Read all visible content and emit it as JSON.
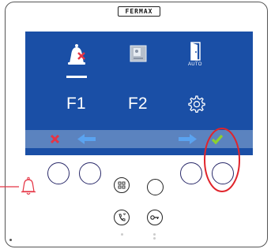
{
  "device": {
    "brand_label": "FERMAX"
  },
  "screen": {
    "icons": [
      "do-not-disturb-bell-icon",
      "intercom-icon",
      "auto-door-icon"
    ],
    "auto_label": "AUTO",
    "f1_label": "F1",
    "f2_label": "F2",
    "settings_icon": "gear-icon"
  },
  "nav_bar": {
    "cancel_icon": "x-icon",
    "left_icon": "arrow-left-icon",
    "right_icon": "arrow-right-icon",
    "confirm_icon": "check-icon"
  },
  "colors": {
    "screen_bg": "#1a4fa6",
    "nav_bar_bg": "#5b83bf",
    "highlight_ring": "#e0242b",
    "confirm_green": "#8bd12f",
    "cancel_red": "#e53545",
    "arrow_blue": "#5aa3f0",
    "bell_red": "#e53545"
  }
}
